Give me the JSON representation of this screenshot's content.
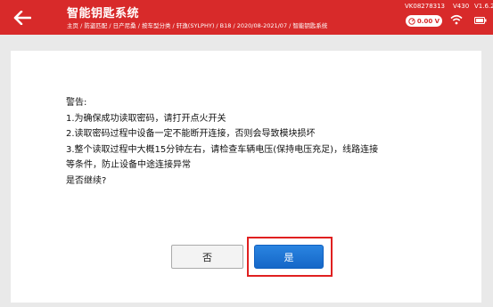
{
  "header": {
    "title": "智能钥匙系统",
    "breadcrumb": "主页 / 防盗匹配 / 日产尼桑 / 按车型分类 / 轩逸(SYLPHY) / B18 / 2020/08-2021/07 / 智能钥匙系统",
    "serial": "VK08278313",
    "model": "V430",
    "version": "V1.6.2",
    "voltage": "0.00 V",
    "back_icon": "back-arrow-icon",
    "wifi_icon": "wifi-icon",
    "battery_icon": "battery-icon",
    "accent_color": "#d82a2a"
  },
  "dialog": {
    "lines": [
      "警告:",
      "1.为确保成功读取密码，请打开点火开关",
      "2.读取密码过程中设备一定不能断开连接，否则会导致模块损坏",
      "3.整个读取过程中大概15分钟左右，请检查车辆电压(保持电压充足)，线路连接",
      "等条件，防止设备中途连接异常",
      "是否继续?"
    ],
    "no_label": "否",
    "yes_label": "是"
  }
}
